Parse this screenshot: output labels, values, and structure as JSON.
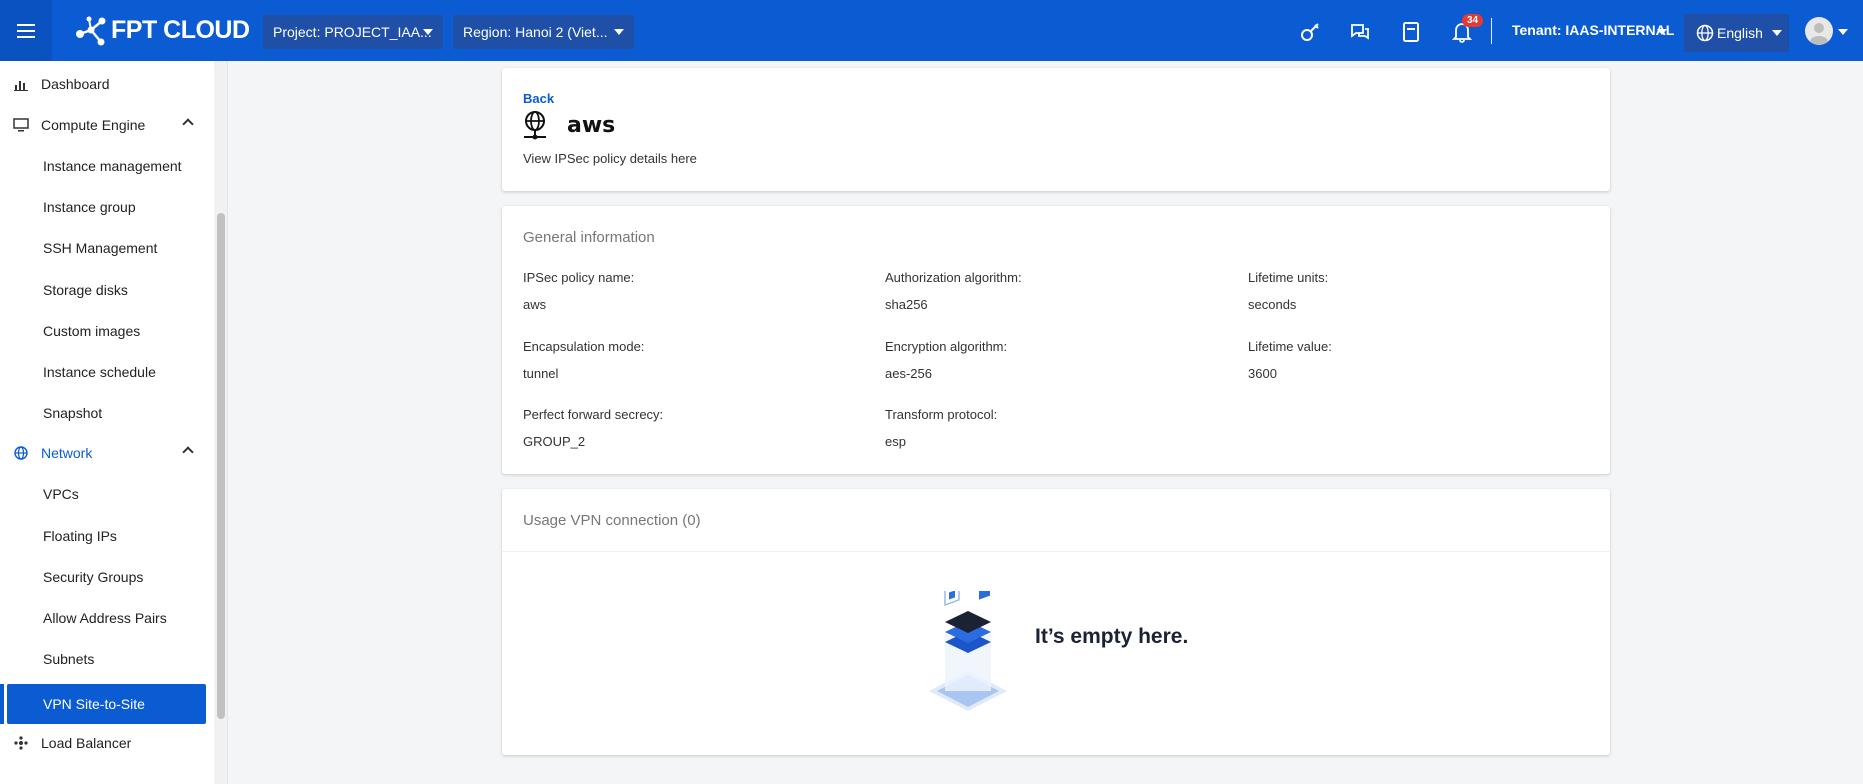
{
  "header": {
    "logo_text": "FPT CLOUD",
    "project_label": "Project: PROJECT_IAA...",
    "region_label": "Region: Hanoi 2 (Viet...",
    "notification_count": "34",
    "tenant_label": "Tenant: IAAS-INTERNAL",
    "language_label": "English",
    "accent_color": "#0b5bd3"
  },
  "sidebar": {
    "items": [
      {
        "label": "Dashboard",
        "icon": "bar-chart-icon"
      },
      {
        "label": "Compute Engine",
        "icon": "monitor-icon"
      },
      {
        "label": "Instance management"
      },
      {
        "label": "Instance group"
      },
      {
        "label": "SSH Management"
      },
      {
        "label": "Storage disks"
      },
      {
        "label": "Custom images"
      },
      {
        "label": "Instance schedule"
      },
      {
        "label": "Snapshot"
      },
      {
        "label": "Network",
        "icon": "globe-icon"
      },
      {
        "label": "VPCs"
      },
      {
        "label": "Floating IPs"
      },
      {
        "label": "Security Groups"
      },
      {
        "label": "Allow Address Pairs"
      },
      {
        "label": "Subnets"
      },
      {
        "label": "VPN Site-to-Site"
      },
      {
        "label": "Load Balancer",
        "icon": "load-balancer-icon"
      }
    ]
  },
  "detail": {
    "back_label": "Back",
    "title": "aws",
    "subtitle": "View IPSec policy details here"
  },
  "general": {
    "section_title": "General information",
    "fields": [
      {
        "label": "IPSec policy name:",
        "value": "aws"
      },
      {
        "label": "Authorization algorithm:",
        "value": "sha256"
      },
      {
        "label": "Lifetime units:",
        "value": "seconds"
      },
      {
        "label": "Encapsulation mode:",
        "value": "tunnel"
      },
      {
        "label": "Encryption algorithm:",
        "value": "aes-256"
      },
      {
        "label": "Lifetime value:",
        "value": "3600"
      },
      {
        "label": "Perfect forward secrecy:",
        "value": "GROUP_2"
      },
      {
        "label": "Transform protocol:",
        "value": "esp"
      }
    ]
  },
  "usage": {
    "section_title": "Usage VPN connection (0)",
    "empty_text": "It’s empty here."
  }
}
